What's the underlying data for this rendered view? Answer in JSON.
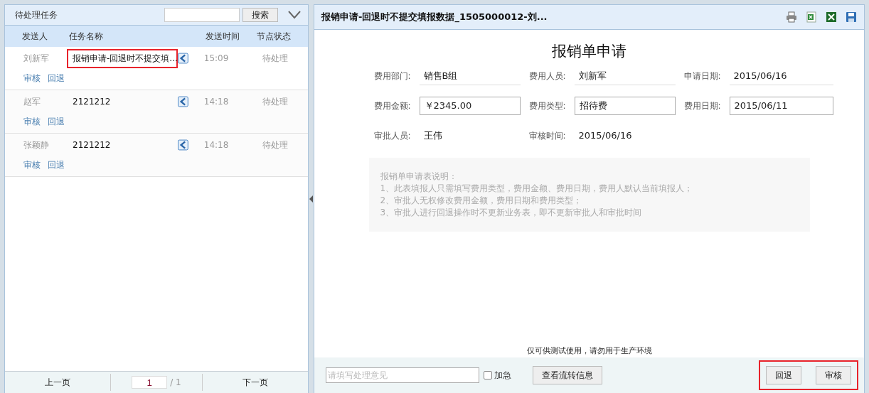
{
  "task_panel": {
    "title": "待处理任务",
    "search": {
      "button": "搜索"
    },
    "columns": [
      "发送人",
      "任务名称",
      "发送时间",
      "节点状态"
    ],
    "rows": [
      {
        "sender": "刘新军",
        "task": "报销申请-回退时不提交填...",
        "highlighted": true,
        "time": "15:09",
        "status": "待处理",
        "actions": [
          "审核",
          "回退"
        ]
      },
      {
        "sender": "赵军",
        "task": "2121212",
        "highlighted": false,
        "time": "14:18",
        "status": "待处理",
        "actions": [
          "审核",
          "回退"
        ]
      },
      {
        "sender": "张颖静",
        "task": "2121212",
        "highlighted": false,
        "time": "14:18",
        "status": "待处理",
        "actions": [
          "审核",
          "回退"
        ]
      }
    ],
    "pager": {
      "prev": "上一页",
      "page": "1",
      "total": "/ 1",
      "next": "下一页"
    }
  },
  "form_panel": {
    "title": "报销申请-回退时不提交填报数据_1505000012-刘...",
    "toolbar": [
      {
        "kind": "print"
      },
      {
        "kind": "excel"
      },
      {
        "kind": "excel-export"
      },
      {
        "kind": "save"
      }
    ],
    "form_title": "报销单申请",
    "fields": [
      {
        "label": "费用部门:",
        "value": "销售B组",
        "kind": "line"
      },
      {
        "label": "费用人员:",
        "value": "刘新军",
        "kind": "line"
      },
      {
        "label": "申请日期:",
        "value": "2015/06/16",
        "kind": "line"
      },
      {
        "label": "费用金额:",
        "value": "￥2345.00",
        "kind": "box"
      },
      {
        "label": "费用类型:",
        "value": "招待费",
        "kind": "box"
      },
      {
        "label": "费用日期:",
        "value": "2015/06/11",
        "kind": "box"
      },
      {
        "label": "审批人员:",
        "value": "王伟",
        "kind": "plain"
      },
      {
        "label": "审核时间:",
        "value": "2015/06/16",
        "kind": "plain"
      }
    ],
    "notes": [
      "报销单申请表说明：",
      "1、此表填报人只需填写费用类型，费用金额、费用日期，费用人默认当前填报人；",
      "2、审批人无权修改费用金额，费用日期和费用类型；",
      "3、审批人进行回退操作时不更新业务表，即不更新审批人和审批时间"
    ],
    "footer_note": "仅可供测试使用，请勿用于生产环境",
    "opinion": {
      "placeholder": "请填写处理意见"
    },
    "urgent": {
      "label": "加急",
      "checked": false
    },
    "flow_button": "查看流转信息",
    "actions": [
      "回退",
      "审核"
    ],
    "actions_highlighted": true
  }
}
